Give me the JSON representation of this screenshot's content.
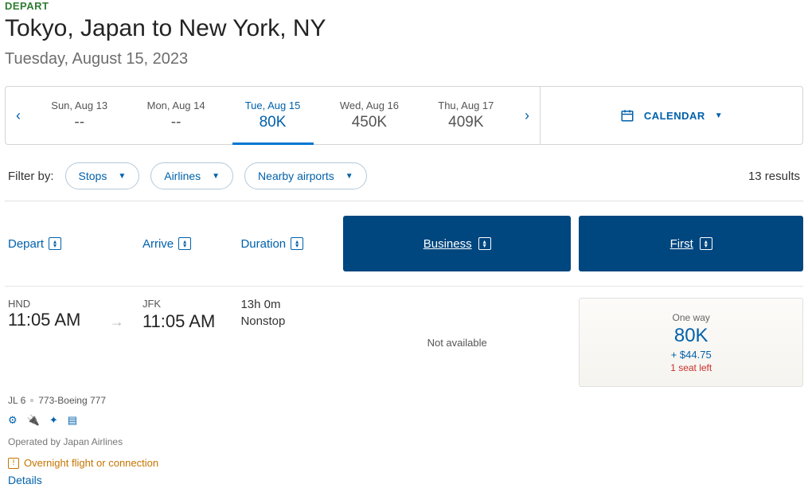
{
  "header": {
    "depart_label": "DEPART",
    "route": "Tokyo, Japan to New York, NY",
    "date": "Tuesday, August 15, 2023"
  },
  "date_strip": {
    "prev": "‹",
    "next": "›",
    "calendar_label": "CALENDAR",
    "cells": [
      {
        "label": "Sun, Aug 13",
        "value": "--"
      },
      {
        "label": "Mon, Aug 14",
        "value": "--"
      },
      {
        "label": "Tue, Aug 15",
        "value": "80K"
      },
      {
        "label": "Wed, Aug 16",
        "value": "450K"
      },
      {
        "label": "Thu, Aug 17",
        "value": "409K"
      }
    ]
  },
  "filters": {
    "label": "Filter by:",
    "stops": "Stops",
    "airlines": "Airlines",
    "nearby": "Nearby airports",
    "results": "13 results"
  },
  "columns": {
    "depart": "Depart",
    "arrive": "Arrive",
    "duration": "Duration",
    "business": "Business",
    "first": "First"
  },
  "flight": {
    "dep_airport": "HND",
    "dep_time": "11:05 AM",
    "arr_airport": "JFK",
    "arr_time": "11:05 AM",
    "duration": "13h 0m",
    "stops": "Nonstop",
    "biz_status": "Not available",
    "fare": {
      "type": "One way",
      "points": "80K",
      "tax": "+ $44.75",
      "seats": "1 seat left"
    },
    "flight_no": "JL 6",
    "aircraft": "773-Boeing 777",
    "operated": "Operated by Japan Airlines",
    "overnight": "Overnight flight or connection",
    "details": "Details"
  }
}
